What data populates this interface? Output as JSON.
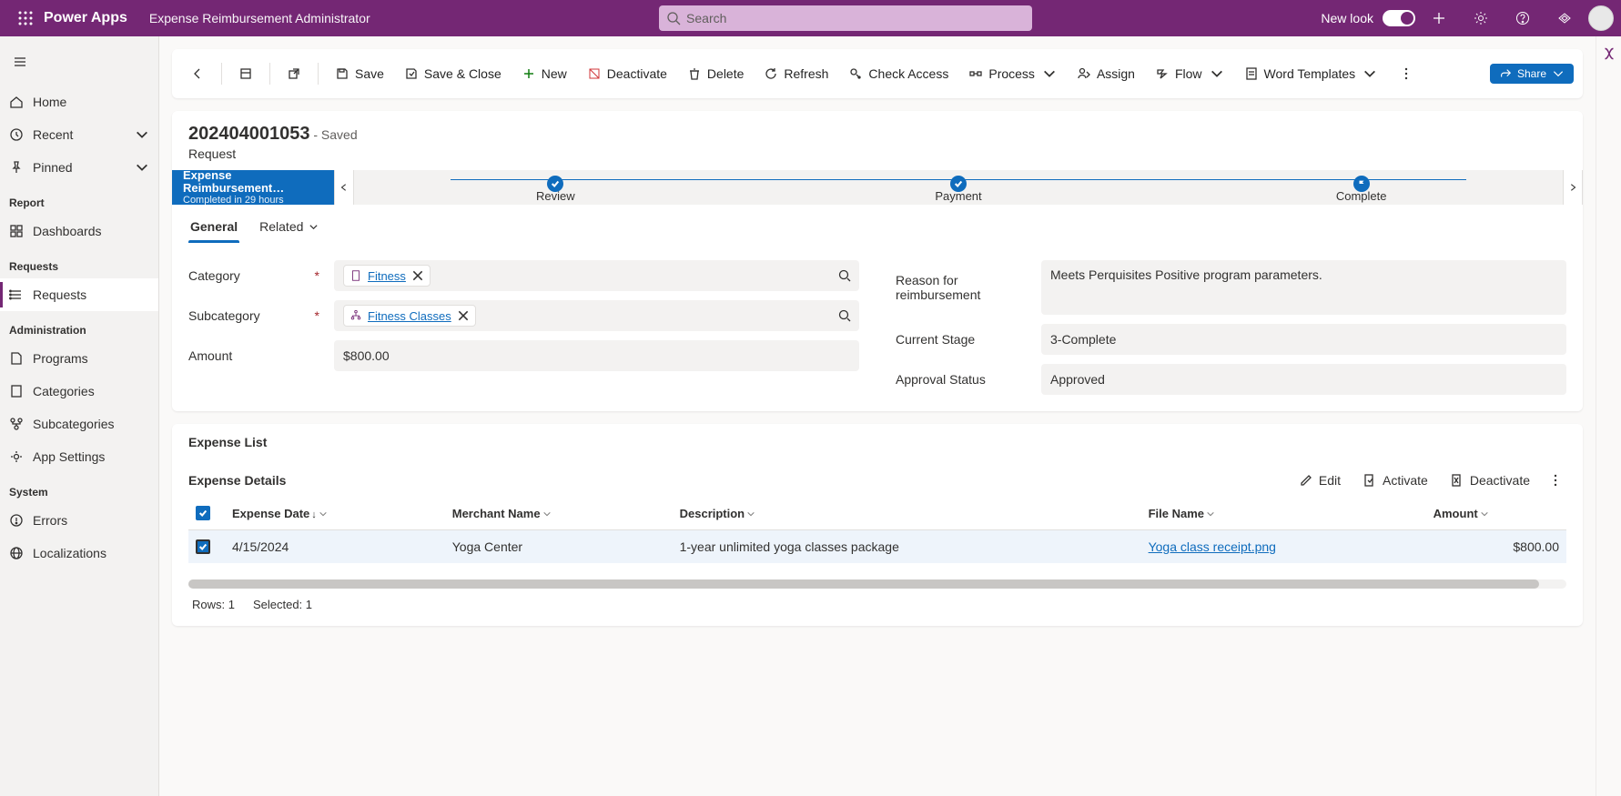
{
  "header": {
    "brand": "Power Apps",
    "app_title": "Expense Reimbursement Administrator",
    "search_placeholder": "Search",
    "new_look_label": "New look"
  },
  "nav": {
    "home": "Home",
    "recent": "Recent",
    "pinned": "Pinned",
    "group_report": "Report",
    "dashboards": "Dashboards",
    "group_requests": "Requests",
    "requests": "Requests",
    "group_admin": "Administration",
    "programs": "Programs",
    "categories": "Categories",
    "subcategories": "Subcategories",
    "app_settings": "App Settings",
    "group_system": "System",
    "errors": "Errors",
    "localizations": "Localizations"
  },
  "commands": {
    "save": "Save",
    "save_close": "Save & Close",
    "new": "New",
    "deactivate": "Deactivate",
    "delete": "Delete",
    "refresh": "Refresh",
    "check_access": "Check Access",
    "process": "Process",
    "assign": "Assign",
    "flow": "Flow",
    "word_templates": "Word Templates",
    "share": "Share"
  },
  "record": {
    "id": "202404001053",
    "saved_suffix": "- Saved",
    "entity": "Request"
  },
  "bpf": {
    "name": "Expense Reimbursement…",
    "status": "Completed in 29 hours",
    "stages": [
      "Review",
      "Payment",
      "Complete"
    ]
  },
  "tabs": {
    "general": "General",
    "related": "Related"
  },
  "fields": {
    "category_label": "Category",
    "category_value": "Fitness",
    "subcategory_label": "Subcategory",
    "subcategory_value": "Fitness Classes",
    "amount_label": "Amount",
    "amount_value": "$800.00",
    "reason_label": "Reason for reimbursement",
    "reason_value": "Meets Perquisites Positive program parameters.",
    "stage_label": "Current Stage",
    "stage_value": "3-Complete",
    "approval_label": "Approval Status",
    "approval_value": "Approved"
  },
  "expense_list": {
    "section_title": "Expense List",
    "subgrid_title": "Expense Details",
    "cmd_edit": "Edit",
    "cmd_activate": "Activate",
    "cmd_deactivate": "Deactivate",
    "columns": {
      "expense_date": "Expense Date",
      "merchant": "Merchant Name",
      "description": "Description",
      "file": "File Name",
      "amount": "Amount"
    },
    "rows": [
      {
        "date": "4/15/2024",
        "merchant": "Yoga Center",
        "description": "1-year unlimited yoga classes package",
        "file": "Yoga class receipt.png",
        "amount": "$800.00"
      }
    ],
    "rows_label": "Rows: 1",
    "selected_label": "Selected: 1"
  }
}
